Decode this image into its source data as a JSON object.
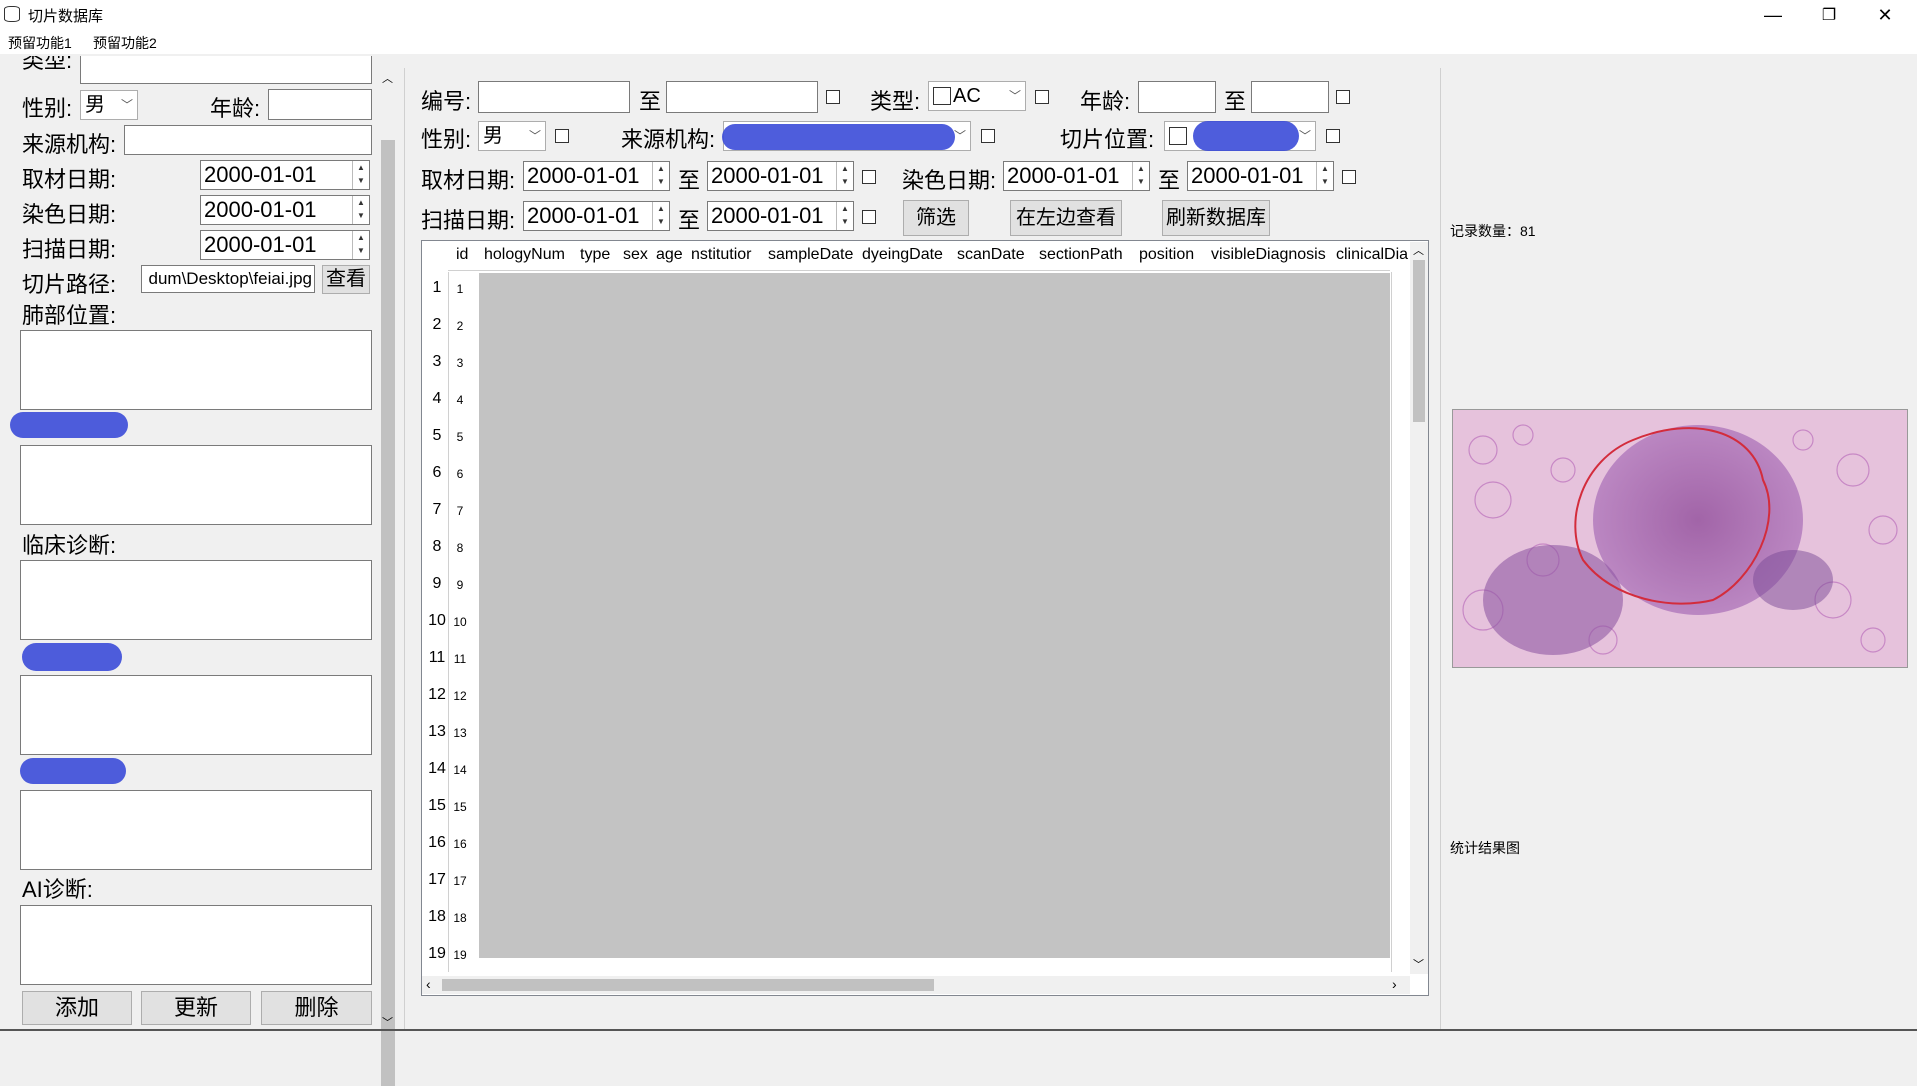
{
  "window": {
    "title": "切片数据库",
    "minimize": "—",
    "restore": "❐",
    "close": "✕"
  },
  "menu": [
    "预留功能1",
    "预留功能2"
  ],
  "left_panel": {
    "type_label": "类型:",
    "sex_label": "性别:",
    "sex_value": "男",
    "age_label": "年龄:",
    "age_value": "",
    "institution_label": "来源机构:",
    "institution_value": "",
    "sample_date_label": "取材日期:",
    "sample_date_value": "2000-01-01",
    "dyeing_date_label": "染色日期:",
    "dyeing_date_value": "2000-01-01",
    "scan_date_label": "扫描日期:",
    "scan_date_value": "2000-01-01",
    "path_label": "切片路径:",
    "path_value": "dum\\Desktop\\feiai.jpg",
    "view_button": "查看",
    "lung_position_label": "肺部位置:",
    "clinical_label": "临床诊断:",
    "ai_label": "AI诊断:",
    "add_button": "添加",
    "update_button": "更新",
    "delete_button": "删除"
  },
  "filters": {
    "number_label": "编号:",
    "to": "至",
    "type_label": "类型:",
    "type_value": "AC",
    "age_label": "年龄:",
    "sex_label": "性别:",
    "sex_value": "男",
    "institution_label": "来源机构:",
    "position_label": "切片位置:",
    "sample_date_label": "取材日期:",
    "dyeing_date_label": "染色日期:",
    "scan_date_label": "扫描日期:",
    "date_value": "2000-01-01",
    "filter_button": "筛选",
    "view_left_button": "在左边查看",
    "refresh_button": "刷新数据库"
  },
  "table": {
    "columns": [
      "id",
      "hologyNum",
      "type",
      "sex",
      "age",
      "nstitutior",
      "sampleDate",
      "dyeingDate",
      "scanDate",
      "sectionPath",
      "position",
      "visibleDiagnosis",
      "clinicalDia"
    ],
    "rows": [
      "1",
      "2",
      "3",
      "4",
      "5",
      "6",
      "7",
      "8",
      "9",
      "10",
      "11",
      "12",
      "13",
      "14",
      "15",
      "16",
      "17",
      "18",
      "19"
    ]
  },
  "right_panel": {
    "record_count": "记录数量：81",
    "stats_label": "统计结果图"
  },
  "colors": {
    "redaction": "#3b4bd8",
    "overlay": "#c3c3c3",
    "background": "#f0f0f0"
  }
}
